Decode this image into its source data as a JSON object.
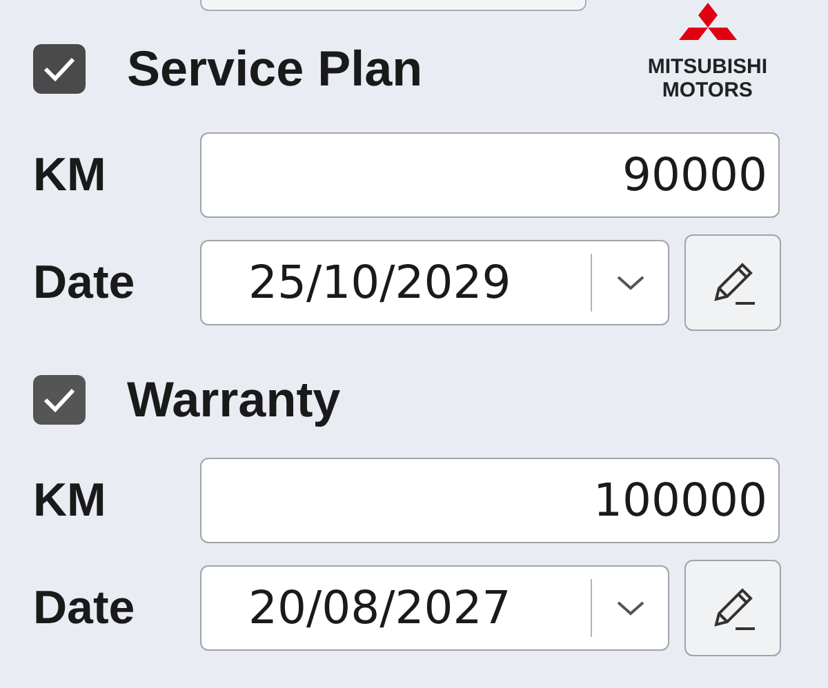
{
  "sections": [
    {
      "title": "Service Plan",
      "checked": true,
      "km_label": "KM",
      "km_value": "90000",
      "date_label": "Date",
      "date_value": "25/10/2029"
    },
    {
      "title": "Warranty",
      "checked": true,
      "km_label": "KM",
      "km_value": "100000",
      "date_label": "Date",
      "date_value": "20/08/2027"
    }
  ],
  "logo": {
    "line_1": "MITSUBISHI",
    "line_2": "MOTORS"
  }
}
